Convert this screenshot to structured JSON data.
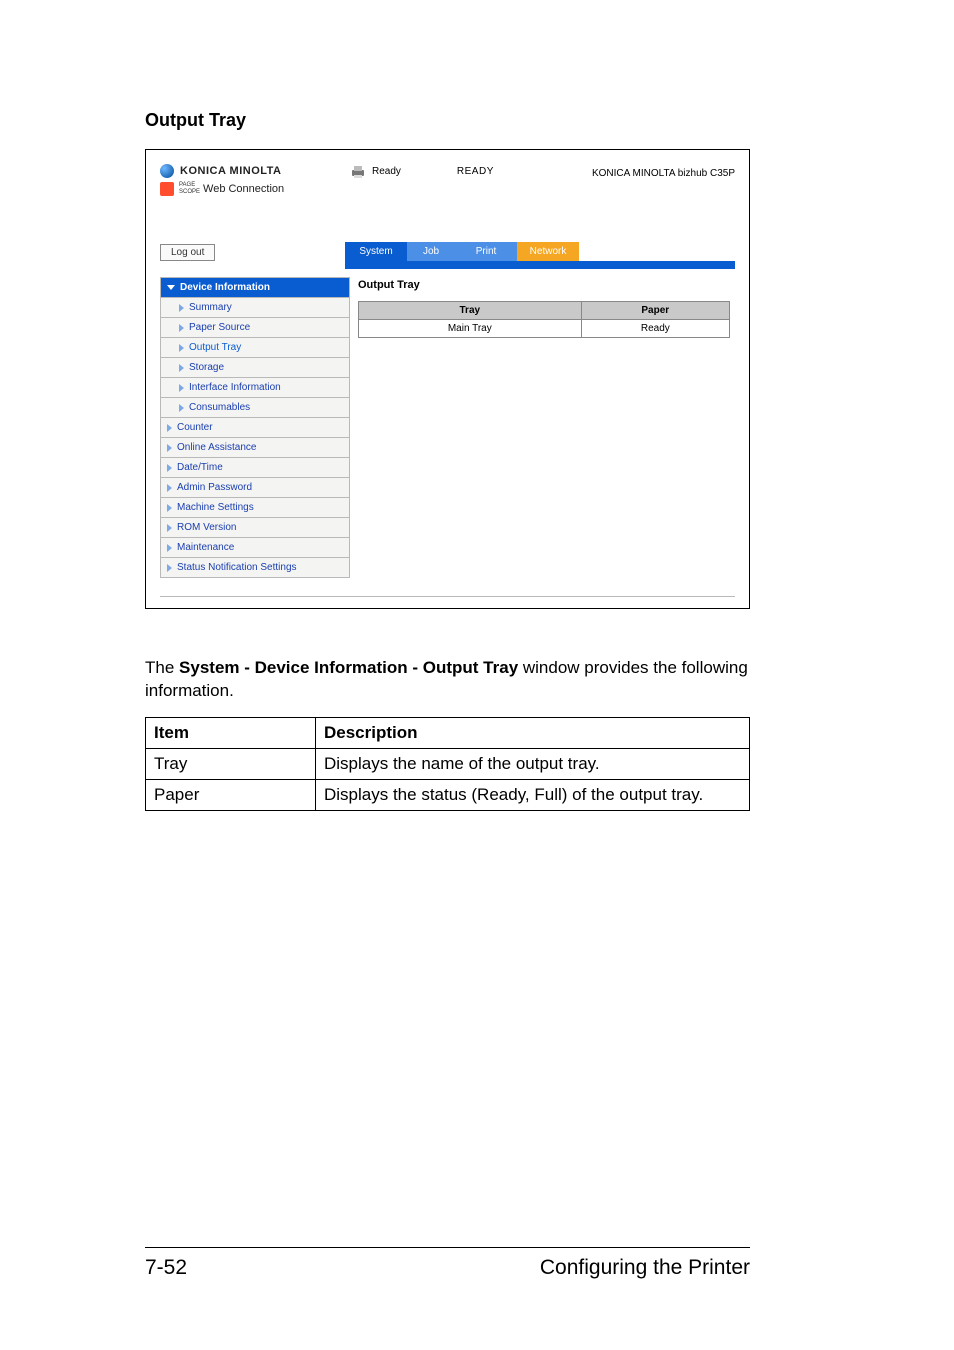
{
  "section_title": "Output Tray",
  "header": {
    "brand": "KONICA MINOLTA",
    "ps_small1": "PAGE",
    "ps_small2": "SCOPE",
    "webconn": "Web Connection",
    "status_label": "Ready",
    "status_big": "READY",
    "device_name": "KONICA MINOLTA bizhub C35P"
  },
  "logout": "Log out",
  "tabs": {
    "system": "System",
    "job": "Job",
    "print": "Print",
    "network": "Network"
  },
  "sidebar": {
    "device_info": "Device Information",
    "summary": "Summary",
    "paper_source": "Paper Source",
    "output_tray": "Output Tray",
    "storage": "Storage",
    "interface": "Interface Information",
    "consumables": "Consumables",
    "counter": "Counter",
    "online": "Online Assistance",
    "datetime": "Date/Time",
    "admin": "Admin Password",
    "machine": "Machine Settings",
    "rom": "ROM Version",
    "maint": "Maintenance",
    "status_notif": "Status Notification Settings"
  },
  "content": {
    "title": "Output Tray",
    "th_tray": "Tray",
    "th_paper": "Paper",
    "td_tray": "Main Tray",
    "td_paper": "Ready"
  },
  "body": {
    "p1a": "The ",
    "p1b": "System - Device Information - Output Tray",
    "p1c": " window provides the following information."
  },
  "table": {
    "h_item": "Item",
    "h_desc": "Description",
    "r1_item": "Tray",
    "r1_desc": "Displays the name of the output tray.",
    "r2_item": "Paper",
    "r2_desc": "Displays the status (Ready, Full) of the output tray."
  },
  "footer": {
    "page": "7-52",
    "title": "Configuring the Printer"
  }
}
